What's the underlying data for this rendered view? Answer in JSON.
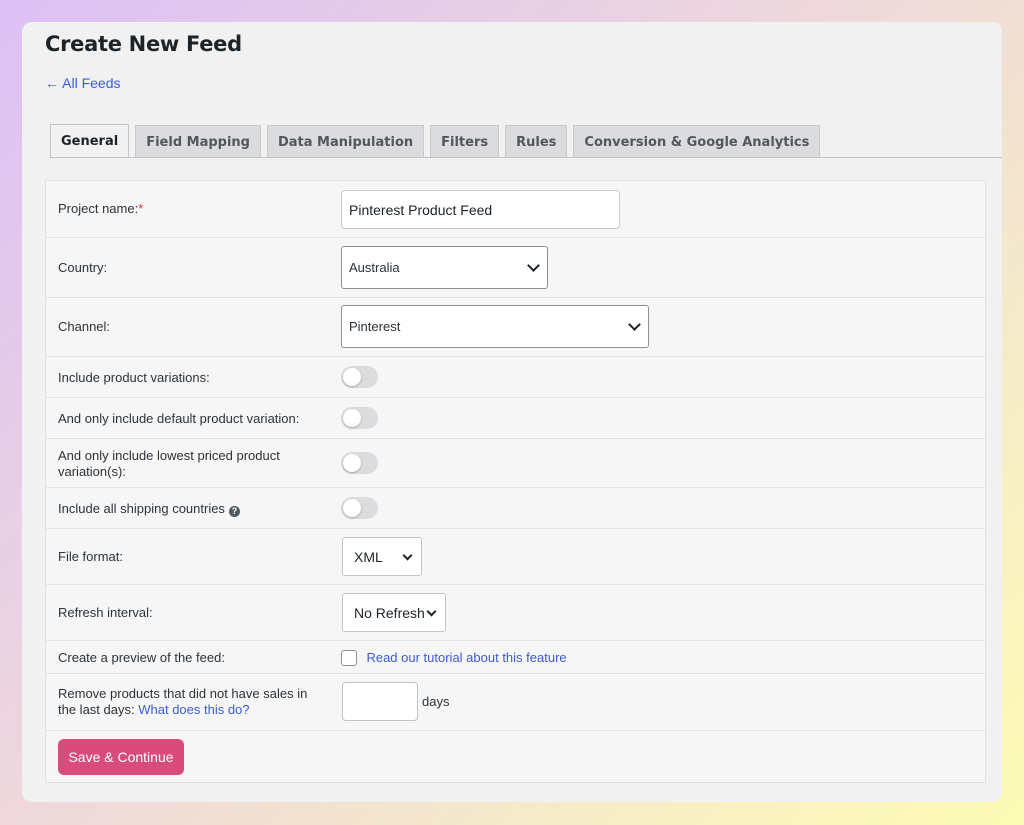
{
  "header": {
    "title": "Create New Feed",
    "back_link": "← All Feeds"
  },
  "tabs": [
    {
      "label": "General",
      "active": true
    },
    {
      "label": "Field Mapping"
    },
    {
      "label": "Data Manipulation"
    },
    {
      "label": "Filters"
    },
    {
      "label": "Rules"
    },
    {
      "label": "Conversion & Google Analytics"
    }
  ],
  "form": {
    "project_name": {
      "label": "Project name:",
      "required_mark": "*",
      "value": "Pinterest Product Feed"
    },
    "country": {
      "label": "Country:",
      "value": "Australia"
    },
    "channel": {
      "label": "Channel:",
      "value": "Pinterest"
    },
    "include_variations": {
      "label": "Include product variations:",
      "enabled": false
    },
    "default_variation": {
      "label": "And only include default product variation:",
      "enabled": false
    },
    "lowest_priced": {
      "label": "And only include lowest priced product variation(s):",
      "enabled": false
    },
    "shipping_countries": {
      "label": "Include all shipping countries",
      "help_icon": "question-icon",
      "enabled": false
    },
    "file_format": {
      "label": "File format:",
      "value": "XML"
    },
    "refresh_interval": {
      "label": "Refresh interval:",
      "value": "No Refresh"
    },
    "preview": {
      "label": "Create a preview of the feed:",
      "checked": false,
      "tutorial_link": "Read our tutorial about this feature"
    },
    "remove_products": {
      "label": "Remove products that did not have sales in the last days:",
      "help_link": "What does this do?",
      "value": "",
      "unit": "days"
    }
  },
  "actions": {
    "save_label": "Save & Continue"
  },
  "colors": {
    "accent": "#d94b7b",
    "link": "#3b5bdb"
  }
}
